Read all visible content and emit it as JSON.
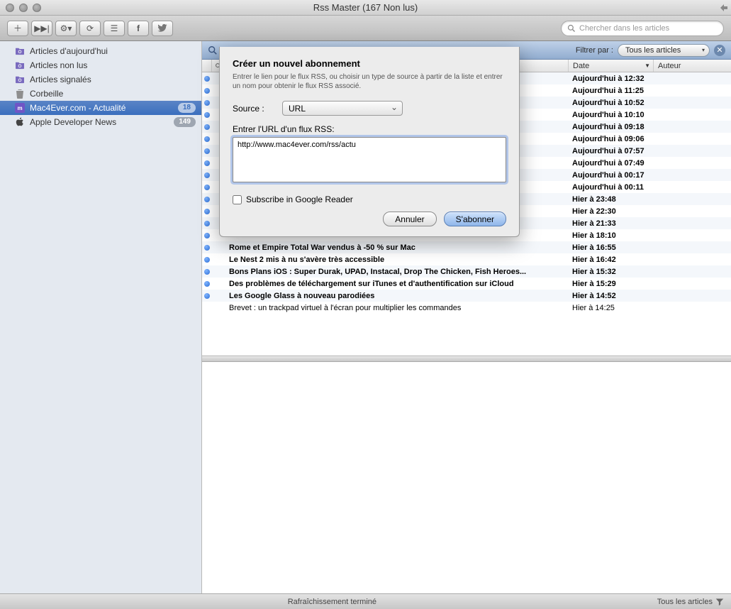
{
  "window": {
    "title": "Rss Master (167 Non lus)"
  },
  "toolbar": {
    "search_placeholder": "Chercher dans les articles"
  },
  "sidebar": {
    "items": [
      {
        "label": "Articles d'aujourd'hui",
        "icon": "smart-folder",
        "badge": null,
        "selected": false
      },
      {
        "label": "Articles non lus",
        "icon": "smart-folder",
        "badge": null,
        "selected": false
      },
      {
        "label": "Articles signalés",
        "icon": "smart-folder",
        "badge": null,
        "selected": false
      },
      {
        "label": "Corbeille",
        "icon": "trash",
        "badge": null,
        "selected": false
      },
      {
        "label": "Mac4Ever.com - Actualité",
        "icon": "feed-purple",
        "badge": "18",
        "selected": true
      },
      {
        "label": "Apple Developer News",
        "icon": "apple",
        "badge": "149",
        "selected": false
      }
    ]
  },
  "filter": {
    "label": "Filtrer par :",
    "value": "Tous les articles"
  },
  "columns": {
    "date": "Date",
    "author": "Auteur"
  },
  "articles": [
    {
      "unread": true,
      "title": "",
      "date": "Aujourd'hui à 12:32"
    },
    {
      "unread": true,
      "title": "",
      "date": "Aujourd'hui à 11:25"
    },
    {
      "unread": true,
      "title": "",
      "date": "Aujourd'hui à 10:52"
    },
    {
      "unread": true,
      "title": "",
      "date": "Aujourd'hui à 10:10"
    },
    {
      "unread": true,
      "title": "",
      "date": "Aujourd'hui à 09:18"
    },
    {
      "unread": true,
      "title": "",
      "date": "Aujourd'hui à 09:06"
    },
    {
      "unread": true,
      "title": "",
      "date": "Aujourd'hui à 07:57"
    },
    {
      "unread": true,
      "title": "",
      "date": "Aujourd'hui à 07:49"
    },
    {
      "unread": true,
      "title": "",
      "date": "Aujourd'hui à 00:17"
    },
    {
      "unread": true,
      "title": "",
      "date": "Aujourd'hui à 00:11"
    },
    {
      "unread": true,
      "title": "",
      "date": "Hier à 23:48"
    },
    {
      "unread": true,
      "title": "",
      "date": "Hier à 22:30"
    },
    {
      "unread": true,
      "title": "",
      "date": "Hier à 21:33"
    },
    {
      "unread": true,
      "title": "",
      "date": "Hier à 18:10"
    },
    {
      "unread": true,
      "title": "Rome et Empire Total War vendus à -50 % sur Mac",
      "date": "Hier à 16:55"
    },
    {
      "unread": true,
      "title": "Le Nest 2 mis à nu s'avère très accessible",
      "date": "Hier à 16:42"
    },
    {
      "unread": true,
      "title": "Bons Plans iOS : Super Durak, UPAD, Instacal, Drop The Chicken, Fish Heroes...",
      "date": "Hier à 15:32"
    },
    {
      "unread": true,
      "title": "Des problèmes de téléchargement sur iTunes et d'authentification sur iCloud",
      "date": "Hier à 15:29"
    },
    {
      "unread": true,
      "title": "Les Google Glass à nouveau parodiées",
      "date": "Hier à 14:52"
    },
    {
      "unread": false,
      "title": "Brevet : un trackpad virtuel à l'écran pour multiplier les commandes",
      "date": "Hier à 14:25"
    }
  ],
  "dialog": {
    "title": "Créer un nouvel abonnement",
    "help": "Entrer le lien pour le flux RSS, ou choisir un type de source à partir de la liste et entrer un nom pour obtenir le flux RSS associé.",
    "source_label": "Source :",
    "source_value": "URL",
    "url_label": "Entrer l'URL d'un flux RSS:",
    "url_value": "http://www.mac4ever.com/rss/actu",
    "google_label": "Subscribe in Google Reader",
    "cancel": "Annuler",
    "submit": "S'abonner"
  },
  "status": {
    "center": "Rafraîchissement terminé",
    "right": "Tous les articles"
  }
}
